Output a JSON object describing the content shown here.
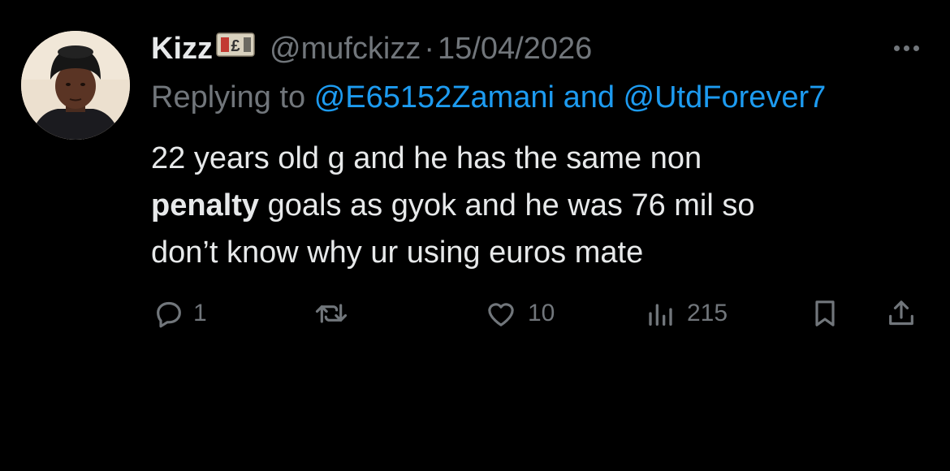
{
  "author": {
    "display_name": "Kizz",
    "handle": "@mufckizz",
    "separator": "·",
    "date": "15/04/2026"
  },
  "reply": {
    "prefix": "Replying to",
    "mention_1": "@E65152Zamani",
    "joiner": "and",
    "mention_2": "@UtdForever7"
  },
  "body": {
    "line1": "22 years old g and he has the same non",
    "line2_bold": "penalty",
    "line2_rest": " goals as gyok and he was 76 mil so",
    "line3": "don’t know why ur using euros mate"
  },
  "actions": {
    "reply_count": "1",
    "retweet_count": "",
    "like_count": "10",
    "view_count": "215"
  },
  "icons": {
    "flag": "pound-banknote-emoji",
    "more": "more-dots-icon",
    "reply": "reply-bubble-icon",
    "retweet": "retweet-icon",
    "like": "heart-icon",
    "views": "views-bar-icon",
    "bookmark": "bookmark-icon",
    "share": "share-icon"
  },
  "colors": {
    "background": "#000000",
    "text": "#e7e9ea",
    "muted": "#71767b",
    "link": "#1d9bf0"
  }
}
